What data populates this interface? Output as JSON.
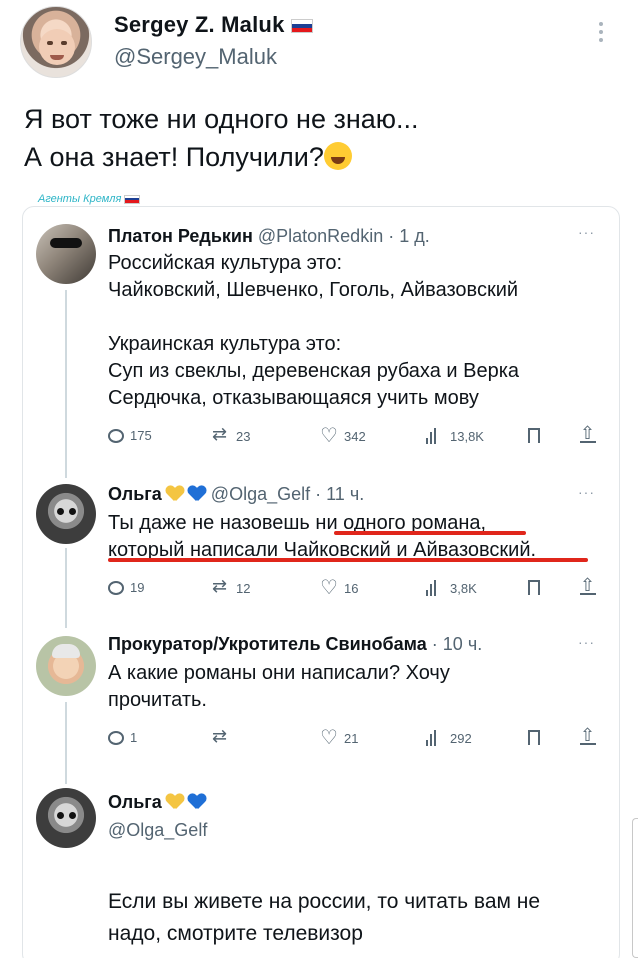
{
  "author": {
    "name": "Sergey Z. Maluk",
    "handle": "@Sergey_Maluk",
    "flag_colors": [
      "#ffffff",
      "#1c3f94",
      "#e4181c"
    ]
  },
  "tweet": {
    "line1": "Я вот тоже ни одного не знаю...",
    "line2": "А она знает! Получили?",
    "emoji": "grinning-sweat-emoji"
  },
  "screenshot": {
    "watermark": "Агенты Кремля",
    "posts": [
      {
        "name": "Платон Редькин",
        "handle": "@PlatonRedkin",
        "time": "· 1 д.",
        "lines": [
          "Российская культура это:",
          "Чайковский, Шевченко, Гоголь, Айвазовский",
          "",
          "Украинская культура это:",
          "Суп из свеклы, деревенская рубаха и Верка",
          "Сердючка, отказывающаяся учить мову"
        ],
        "stats": {
          "replies": "175",
          "retweets": "23",
          "likes": "342",
          "views": "13,8K"
        }
      },
      {
        "name": "Ольга",
        "handle": "@Olga_Gelf",
        "time": "· 11 ч.",
        "lines": [
          "Ты даже не назовешь ни одного романа,",
          "который написали Чайковский и Айвазовский."
        ],
        "stats": {
          "replies": "19",
          "retweets": "12",
          "likes": "16",
          "views": "3,8K"
        }
      },
      {
        "name": "Прокуратор/Укротитель Свинобама",
        "handle": "",
        "time": "· 10 ч.",
        "lines": [
          "А какие романы они написали? Хочу",
          "прочитать."
        ],
        "stats": {
          "replies": "1",
          "retweets": "",
          "likes": "21",
          "views": "292"
        }
      },
      {
        "name": "Ольга",
        "handle": "@Olga_Gelf",
        "time": "",
        "lines": [
          "Если вы живете на россии, то читать вам не",
          "надо, смотрите телевизор"
        ]
      }
    ],
    "highlight_color": "#e0261b",
    "heart_colors": [
      "#f4c542",
      "#1f6fd6"
    ]
  }
}
